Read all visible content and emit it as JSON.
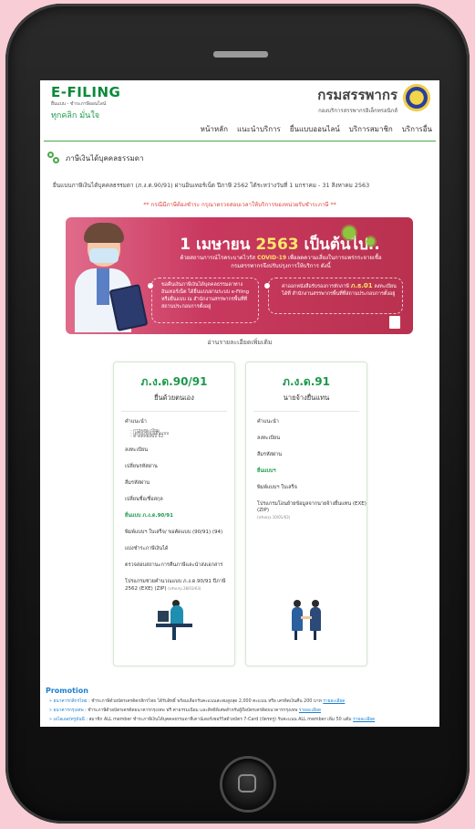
{
  "header": {
    "efiling_title": "E-FILING",
    "efiling_sub": "ยื่นแบบ - ชำระภาษีออนไลน์",
    "efiling_slogan": "ทุกคลิก มั่นใจ",
    "rd_title": "กรมสรรพากร",
    "rd_sub": "กองบริการสรรพากรอิเล็กทรอนิกส์"
  },
  "nav": {
    "items": [
      "หน้าหลัก",
      "แนะนำบริการ",
      "ยื่นแบบออนไลน์",
      "บริการสมาชิก",
      "บริการอื่น"
    ]
  },
  "section": {
    "title": "ภาษีเงินได้บุคคลธรรมดา",
    "period": "ยื่นแบบภาษีเงินได้บุคคลธรรมดา (ภ.ง.ด.90/91) ผ่านอินเทอร์เน็ต ปีภาษี 2562 ได้ระหว่างวันที่ 1 มกราคม - 31 สิงหาคม 2563",
    "warning": "** กรณีมีภาษีต้องชำระ กรุณาตรวจสอบเวลาให้บริการของหน่วยรับชำระภาษี **"
  },
  "banner": {
    "title_pre": "1 เมษายน ",
    "title_year": "2563",
    "title_post": " เป็นต้นไป..",
    "sub_1": "ด้วยสถานการณ์โรคระบาดไวรัส ",
    "sub_hl": "COVID-19",
    "sub_2": " เพื่อลดความเสี่ยงในการแพร่กระจายเชื้อ",
    "sub_3": "กรมสรรพากรจึงปรับปรุงการให้บริการ ดังนี้",
    "left_text": "ขอคืนเงินภาษีเงินได้บุคคลธรรมดาทางอินเทอร์เน็ต ได้ยื่นแบบผ่านระบบ e-Filing หรือยื่นแบบ ณ สำนักงานสรรพากรพื้นที่ที่สถานประกอบการตั้งอยู่",
    "right_text_1": "ค่าออกหนังสือรับรองการหักภาษี ",
    "right_hl": "ภ.ธ.01",
    "right_text_2": " ลงทะเบียนได้ที่ สำนักงานสรรพากรพื้นที่ที่สถานประกอบการตั้งอยู่"
  },
  "read_more": "อ่านรายละเอียดเพิ่มเติม",
  "cards": {
    "left": {
      "form": "ภ.ง.ด.90/91",
      "desc": "ยื่นด้วยตนเอง",
      "items": [
        {
          "label": "คำแนะนำ",
          "sub": [
            "- การลงทะเบียน",
            "- เตรียมข้อมูลยื่นแบบ",
            "- ค่าลดหย่อนปี 62"
          ]
        },
        {
          "label": "ลงทะเบียน"
        },
        {
          "label": "เปลี่ยนรหัสผ่าน"
        },
        {
          "label": "ลืมรหัสผ่าน"
        },
        {
          "label": "เปลี่ยนชื่อ/ชื่อสกุล"
        },
        {
          "label": "ยื่นแบบ ภ.ง.ด.90/91",
          "active": true
        },
        {
          "label": "พิมพ์แบบฯ ใบเสร็จ/ ขอคัดแบบ (90/91) (94)"
        },
        {
          "label": "แบ่งชำระภาษีเงินได้"
        },
        {
          "label": "ตรวจสอบสถานะการคืนภาษีและนำส่งเอกสาร"
        },
        {
          "label": "โปรแกรมช่วยคำนวณแบบ ภ.ง.ด.90/91 ปีภาษี 2562 (EXE) (ZIP)",
          "note": "(ปรับปรุง 28/03/63)"
        }
      ]
    },
    "right": {
      "form": "ภ.ง.ด.91",
      "desc": "นายจ้างยื่นแทน",
      "items": [
        {
          "label": "คำแนะนำ"
        },
        {
          "label": "ลงทะเบียน"
        },
        {
          "label": "ลืมรหัสผ่าน"
        },
        {
          "label": "ยื่นแบบฯ",
          "active": true
        },
        {
          "label": "พิมพ์แบบฯ ใบเสร็จ"
        },
        {
          "label": "โปรแกรมโอนย้ายข้อมูลจากนายจ้างยื่นแทน (EXE) (ZIP)",
          "note": "(ปรับปรุง 10/01/63)"
        }
      ]
    }
  },
  "promotion": {
    "title": "Promotion",
    "items": [
      {
        "name": "ธนาคารกสิกรไทย",
        "text": " : ชำระภาษีด้วยบัตรเครดิตกสิกรไทย ได้รับสิทธิ์ พร้อมเลือกรับคะแนนสะสมสูงสุด 2,000 คะแนน หรือ เครดิตเงินคืน 200 บาท ",
        "more": "รายละเอียด"
      },
      {
        "name": "ธนาคารกรุงเทพ",
        "text": " : ชำระภาษีด้วยบัตรเครดิตธนาคารกรุงเทพ ฟรี ค่าธรรมเนียม และสิทธิพิเศษสำหรับผู้ถือบัตรเครดิตธนาคารกรุงเทพ ",
        "more": "รายละเอียด"
      },
      {
        "name": "เอไอเอส/ทรูมันนี่",
        "text": " : สมาชิก ALL member ชำระภาษีเงินได้บุคคลธรรมดาที่เคาน์เตอร์เซอร์วิสด้วยบัตร 7-Card (บัตรทรู) รับคะแนน ALL member เพิ่ม 50 แต้ม ",
        "more": "รายละเอียด"
      }
    ]
  },
  "colors": {
    "accent": "#1a9a4a",
    "banner": "#c9395f",
    "promo": "#1a7fd0",
    "warning": "#e0453c"
  },
  "icons": [
    "home-button-icon",
    "section-leaf-icon",
    "covid-virus-icon",
    "government-seal-icon"
  ]
}
